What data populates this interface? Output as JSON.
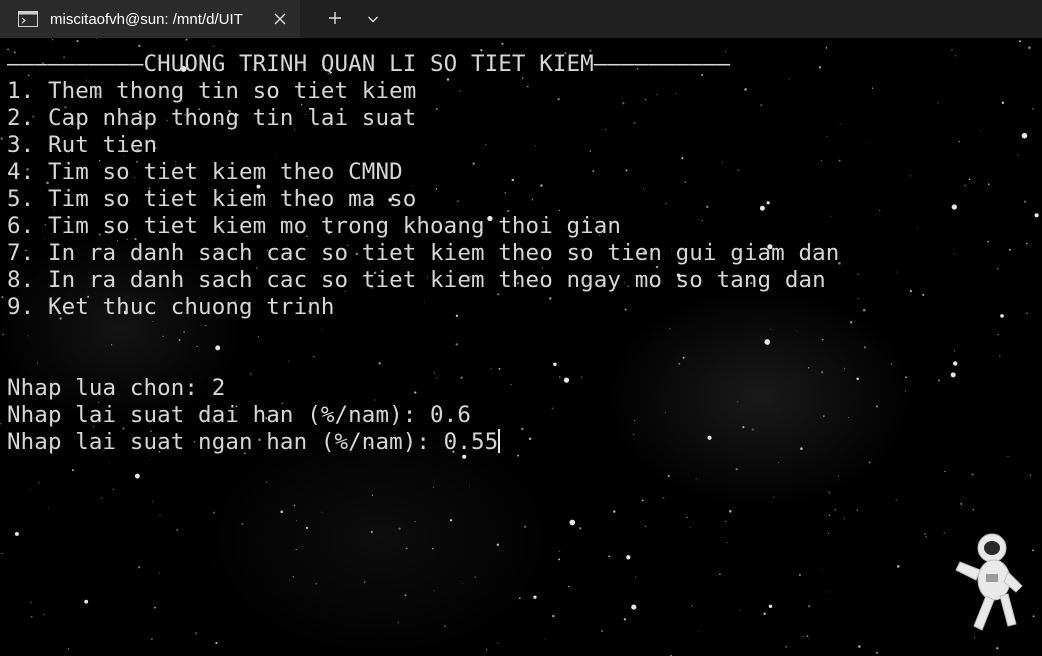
{
  "window": {
    "tab_title": "miscitaofvh@sun: /mnt/d/UIT",
    "icons": {
      "tab": "terminal-icon",
      "close": "close-icon",
      "new_tab": "plus-icon",
      "dropdown": "chevron-down-icon"
    }
  },
  "terminal": {
    "lines": [
      "——————————CHUONG TRINH QUAN LI SO TIET KIEM——————————",
      "1. Them thong tin so tiet kiem",
      "2. Cap nhap thong tin lai suat",
      "3. Rut tien",
      "4. Tim so tiet kiem theo CMND",
      "5. Tim so tiet kiem theo ma so",
      "6. Tim so tiet kiem mo trong khoang thoi gian",
      "7. In ra danh sach cac so tiet kiem theo so tien gui giam dan",
      "8. In ra danh sach cac so tiet kiem theo ngay mo so tang dan",
      "9. Ket thuc chuong trinh",
      "",
      "",
      "Nhap lua chon: 2",
      "Nhap lai suat dai han (%/nam): 0.6",
      "Nhap lai suat ngan han (%/nam): 0.55"
    ]
  },
  "colors": {
    "titlebar": "#202020",
    "tab": "#2b2b2b",
    "text": "#d6d6d6",
    "background": "#000000"
  }
}
